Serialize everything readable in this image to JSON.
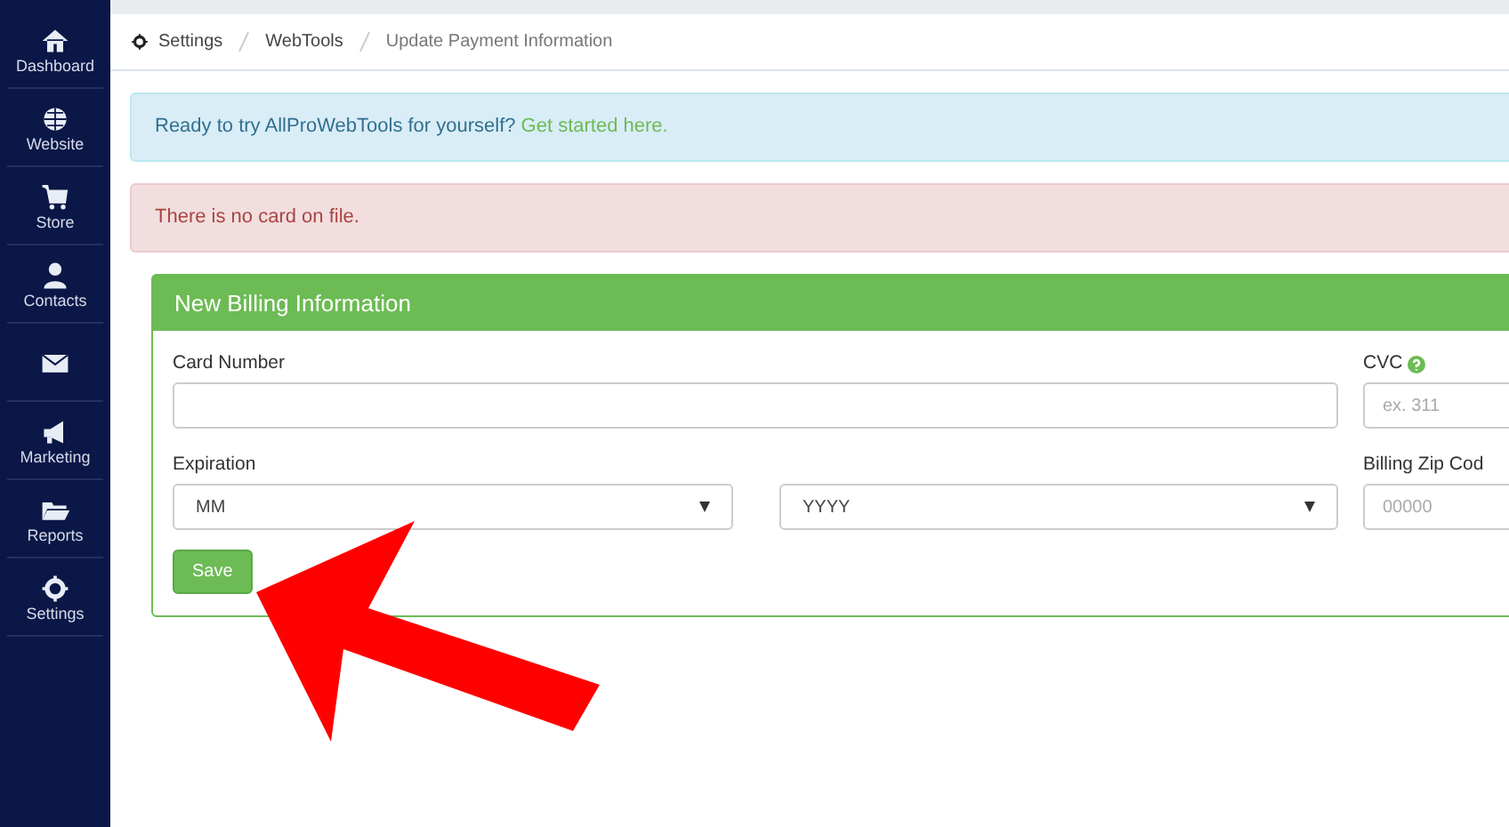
{
  "sidebar": {
    "items": [
      {
        "kind": "home",
        "label": "Dashboard"
      },
      {
        "kind": "globe",
        "label": "Website"
      },
      {
        "kind": "cart",
        "label": "Store"
      },
      {
        "kind": "person",
        "label": "Contacts"
      },
      {
        "kind": "envelope"
      },
      {
        "kind": "megaphone",
        "label": "Marketing"
      },
      {
        "kind": "folder",
        "label": "Reports"
      },
      {
        "kind": "gear",
        "label": "Settings"
      }
    ]
  },
  "breadcrumb": [
    "Settings",
    "WebTools",
    "Update Payment Information"
  ],
  "alerts": [
    {
      "kind": "info",
      "text": "Ready to try AllProWebTools for yourself?",
      "link": "Get started here."
    },
    {
      "kind": "danger",
      "text": "There is no card on file."
    }
  ],
  "panel": {
    "title": "New Billing Information",
    "card_number": {
      "label": "Card Number"
    },
    "cvc": {
      "label": "CVC",
      "placeholder": "ex. 311"
    },
    "expiration": {
      "label": "Expiration",
      "month": "MM",
      "year": "YYYY"
    },
    "zip": {
      "label": "Billing Zip Cod",
      "placeholder": "00000"
    },
    "save_button": "Save"
  },
  "annotation": {
    "kind": "arrow"
  }
}
